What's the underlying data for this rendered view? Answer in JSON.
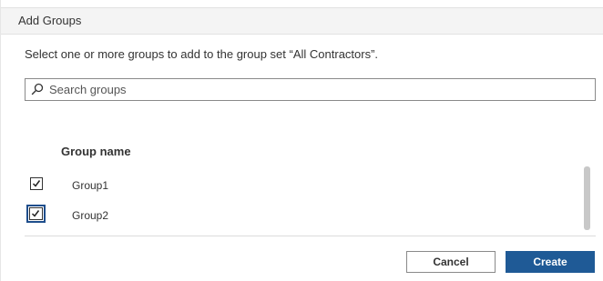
{
  "dialog": {
    "title": "Add Groups",
    "instructions": "Select one or more groups to add to the group set “All Contractors”."
  },
  "search": {
    "placeholder": "Search groups",
    "value": ""
  },
  "table": {
    "column_header": "Group name",
    "rows": [
      {
        "label": "Group1",
        "checked": true
      },
      {
        "label": "Group2",
        "checked": true
      }
    ]
  },
  "buttons": {
    "cancel": "Cancel",
    "create": "Create"
  },
  "colors": {
    "primary": "#1f5a96",
    "focus": "#1f4e8c"
  },
  "icons": {
    "search": "search-icon",
    "checkbox": "checkmark-icon"
  }
}
